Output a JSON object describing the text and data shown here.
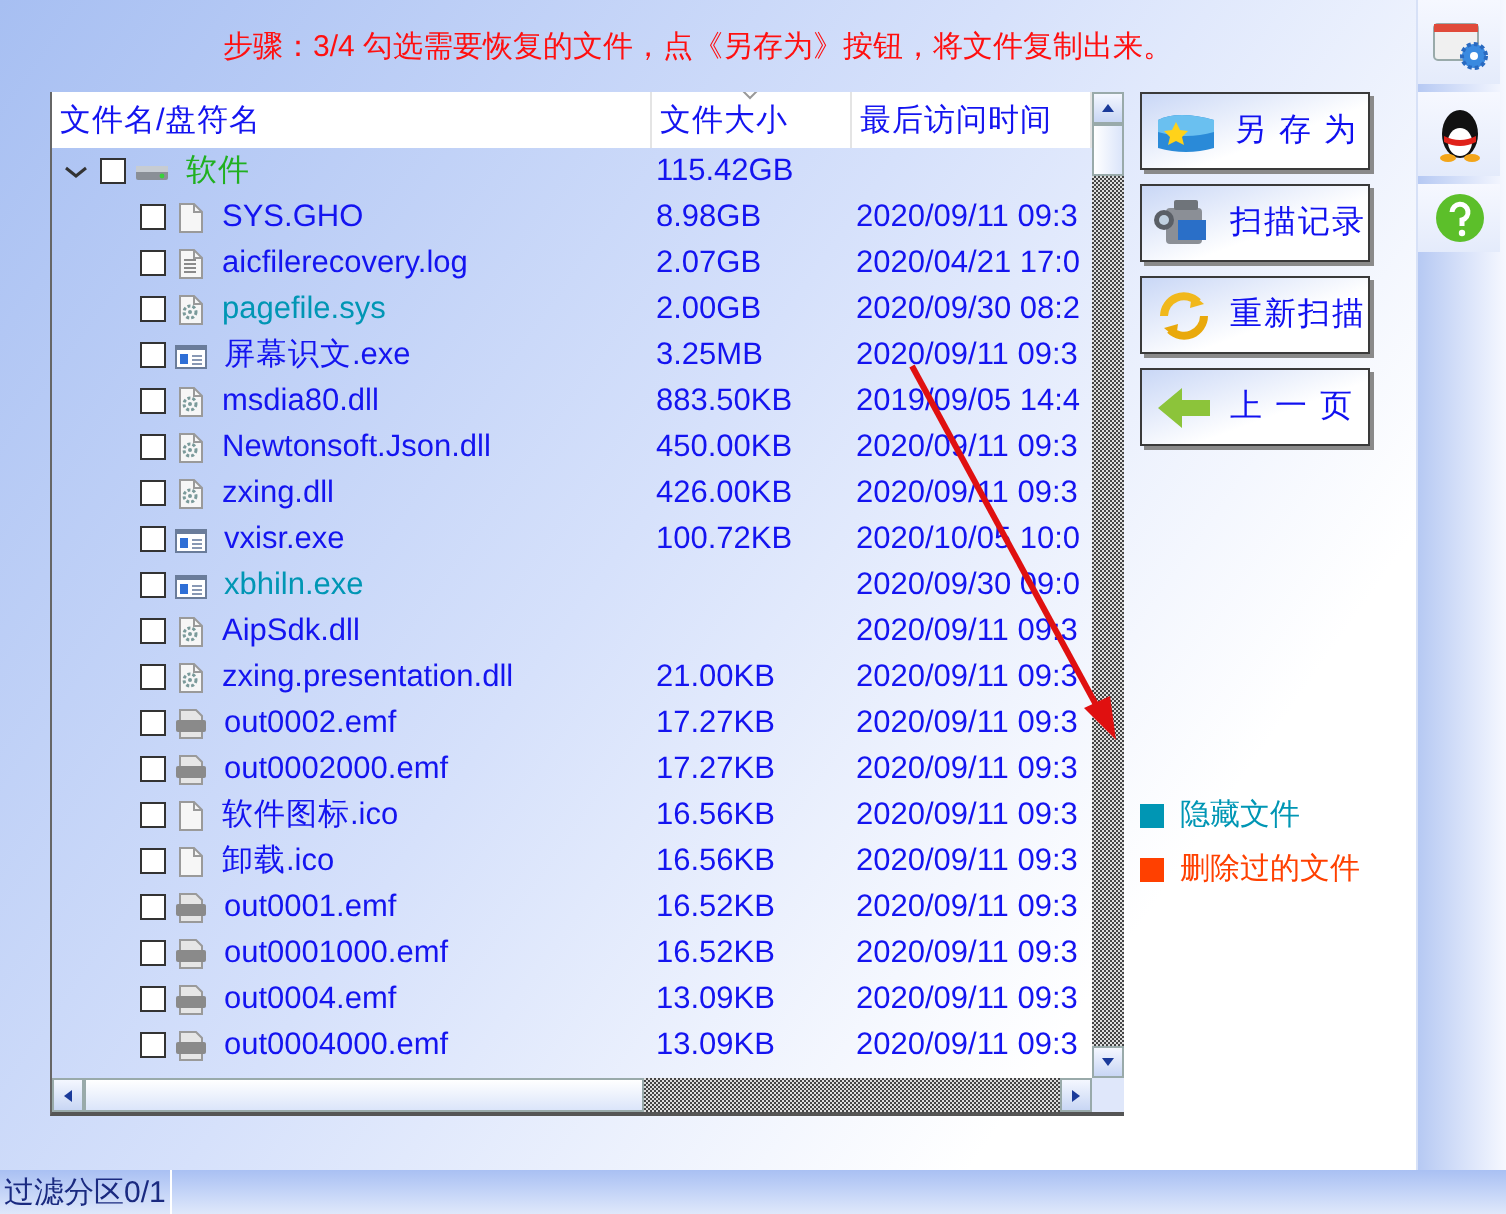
{
  "banner": {
    "text": "步骤：3/4 勾选需要恢复的文件，点《另存为》按钮，将文件复制出来。"
  },
  "table": {
    "columns": [
      {
        "label": "文件名/盘符名",
        "sorted": false
      },
      {
        "label": "文件大小",
        "sorted": true
      },
      {
        "label": "最后访问时间",
        "sorted": false
      }
    ],
    "tree": [
      {
        "name": "软件",
        "kind": "drive",
        "size": "115.42GB",
        "checked": false,
        "expanded": true,
        "children": [
          {
            "name": "SYS.GHO",
            "kind": "blank",
            "size": "8.98GB",
            "date": "2020/09/11 09:3",
            "checked": false,
            "hidden": false
          },
          {
            "name": "aicfilerecovery.log",
            "kind": "text",
            "size": "2.07GB",
            "date": "2020/04/21 17:0",
            "checked": false,
            "hidden": false
          },
          {
            "name": "pagefile.sys",
            "kind": "gear",
            "size": "2.00GB",
            "date": "2020/09/30 08:2",
            "checked": false,
            "hidden": true
          },
          {
            "name": "屏幕识文.exe",
            "kind": "exe",
            "size": "3.25MB",
            "date": "2020/09/11 09:3",
            "checked": false,
            "hidden": false
          },
          {
            "name": "msdia80.dll",
            "kind": "gear",
            "size": "883.50KB",
            "date": "2019/09/05 14:4",
            "checked": false,
            "hidden": false
          },
          {
            "name": "Newtonsoft.Json.dll",
            "kind": "gear",
            "size": "450.00KB",
            "date": "2020/09/11 09:3",
            "checked": false,
            "hidden": false
          },
          {
            "name": "zxing.dll",
            "kind": "gear",
            "size": "426.00KB",
            "date": "2020/09/11 09:3",
            "checked": false,
            "hidden": false
          },
          {
            "name": "vxisr.exe",
            "kind": "exe",
            "size": "100.72KB",
            "date": "2020/10/05 10:0",
            "checked": false,
            "hidden": false
          },
          {
            "name": "xbhiln.exe",
            "kind": "exe",
            "date": "2020/09/30 09:0",
            "checked": false,
            "hidden": true
          },
          {
            "name": "AipSdk.dll",
            "kind": "gear",
            "date": "2020/09/11 09:3",
            "checked": false,
            "hidden": false
          },
          {
            "name": "zxing.presentation.dll",
            "kind": "gear",
            "size": "21.00KB",
            "date": "2020/09/11 09:3",
            "checked": false,
            "hidden": false
          },
          {
            "name": "out0002.emf",
            "kind": "emf",
            "size": "17.27KB",
            "date": "2020/09/11 09:3",
            "checked": false,
            "hidden": false
          },
          {
            "name": "out0002000.emf",
            "kind": "emf",
            "size": "17.27KB",
            "date": "2020/09/11 09:3",
            "checked": false,
            "hidden": false
          },
          {
            "name": "软件图标.ico",
            "kind": "blank",
            "size": "16.56KB",
            "date": "2020/09/11 09:3",
            "checked": false,
            "hidden": false
          },
          {
            "name": "卸载.ico",
            "kind": "blank",
            "size": "16.56KB",
            "date": "2020/09/11 09:3",
            "checked": false,
            "hidden": false
          },
          {
            "name": "out0001.emf",
            "kind": "emf",
            "size": "16.52KB",
            "date": "2020/09/11 09:3",
            "checked": false,
            "hidden": false
          },
          {
            "name": "out0001000.emf",
            "kind": "emf",
            "size": "16.52KB",
            "date": "2020/09/11 09:3",
            "checked": false,
            "hidden": false
          },
          {
            "name": "out0004.emf",
            "kind": "emf",
            "size": "13.09KB",
            "date": "2020/09/11 09:3",
            "checked": false,
            "hidden": false
          },
          {
            "name": "out0004000.emf",
            "kind": "emf",
            "size": "13.09KB",
            "date": "2020/09/11 09:3",
            "checked": false,
            "hidden": false
          }
        ]
      }
    ]
  },
  "buttons": [
    {
      "label": "另 存 为",
      "kind": "save"
    },
    {
      "label": "扫描记录",
      "kind": "record"
    },
    {
      "label": "重新扫描",
      "kind": "rescan"
    },
    {
      "label": "上 一 页",
      "kind": "back"
    }
  ],
  "legend": [
    {
      "label": "隐藏文件",
      "color": "#0096b4"
    },
    {
      "label": "删除过的文件",
      "color": "#ff4000"
    }
  ],
  "status_bar": {
    "text": "过滤分区0/1"
  }
}
